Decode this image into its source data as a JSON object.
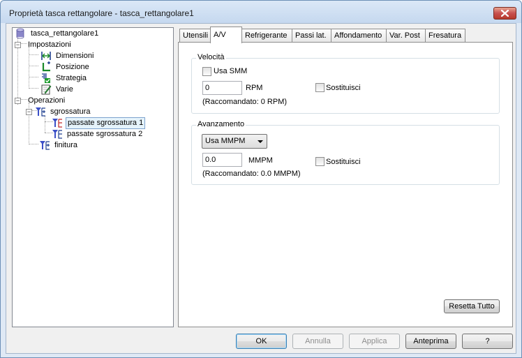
{
  "window": {
    "title": "Proprietà tasca rettangolare - tasca_rettangolare1",
    "close_icon": "close-x-icon"
  },
  "tree": {
    "root": {
      "label": "tasca_rettangolare1",
      "icon": "cylinder-icon"
    },
    "settings": {
      "label": "Impostazioni",
      "expander": "−"
    },
    "dimensions": {
      "label": "Dimensioni",
      "icon": "dimensions-icon"
    },
    "position": {
      "label": "Posizione",
      "icon": "position-axes-icon"
    },
    "strategy": {
      "label": "Strategia",
      "icon": "strategy-icon"
    },
    "misc": {
      "label": "Varie",
      "icon": "pencil-sheet-icon"
    },
    "operations": {
      "label": "Operazioni",
      "expander": "−"
    },
    "roughing": {
      "label": "sgrossatura",
      "expander": "−",
      "icon": "tool-operation-icon"
    },
    "roughing_pass1": {
      "label": "passate sgrossatura 1",
      "icon": "tool-pass-icon"
    },
    "roughing_pass2": {
      "label": "passate sgrossatura 2",
      "icon": "tool-pass-icon"
    },
    "finishing": {
      "label": "finitura",
      "icon": "tool-operation-icon"
    }
  },
  "tabs": [
    {
      "label": "Utensili"
    },
    {
      "label": "A/V"
    },
    {
      "label": "Refrigerante"
    },
    {
      "label": "Passi lat."
    },
    {
      "label": "Affondamento"
    },
    {
      "label": "Var. Post"
    },
    {
      "label": "Fresatura"
    }
  ],
  "active_tab": "A/V",
  "speed": {
    "legend": "Velocità",
    "use_smm_label": "Usa SMM",
    "use_smm_checked": false,
    "value": "0",
    "unit": "RPM",
    "override_label": "Sostituisci",
    "override_checked": false,
    "recommended": "(Raccomandato:  0 RPM)"
  },
  "feed": {
    "legend": "Avanzamento",
    "mode_selected": "Usa MMPM",
    "value": "0.0",
    "unit": "MMPM",
    "override_label": "Sostituisci",
    "override_checked": false,
    "recommended": "(Raccomandato:  0.0 MMPM)"
  },
  "reset_all_label": "Resetta Tutto",
  "footer": {
    "ok_label": "OK",
    "cancel_label": "Annulla",
    "apply_label": "Applica",
    "preview_label": "Anteprima",
    "help_label": "?"
  }
}
